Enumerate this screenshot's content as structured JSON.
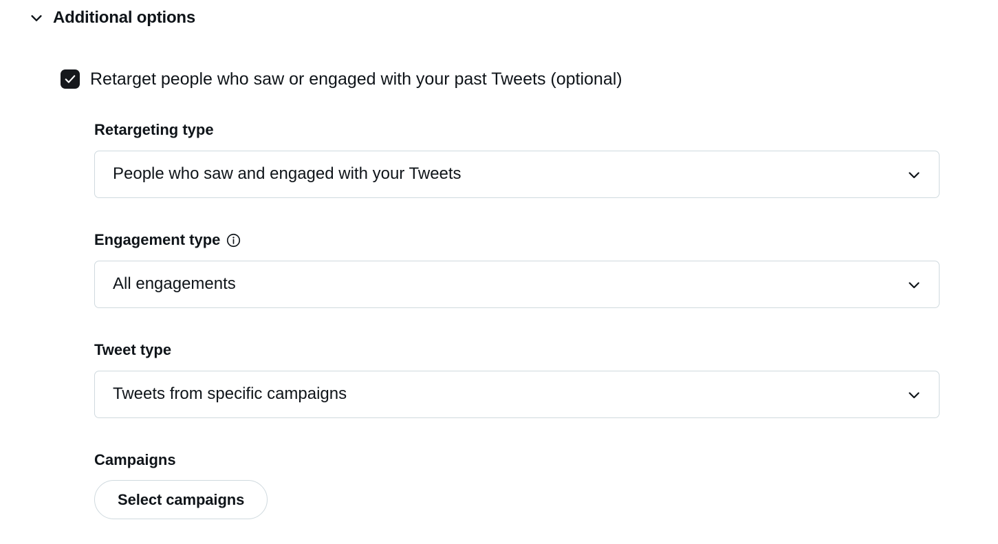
{
  "section": {
    "title": "Additional options",
    "toggle_icon": "chevron-down-icon",
    "expanded": true
  },
  "retarget_checkbox": {
    "label": "Retarget people who saw or engaged with your past Tweets (optional)",
    "checked": true,
    "check_icon": "checkmark-icon"
  },
  "fields": {
    "retargeting_type": {
      "label": "Retargeting type",
      "value": "People who saw and engaged with your Tweets",
      "chevron_icon": "chevron-down-icon"
    },
    "engagement_type": {
      "label": "Engagement type",
      "info_icon": "info-circle-icon",
      "value": "All engagements",
      "chevron_icon": "chevron-down-icon"
    },
    "tweet_type": {
      "label": "Tweet type",
      "value": "Tweets from specific campaigns",
      "chevron_icon": "chevron-down-icon"
    },
    "campaigns": {
      "label": "Campaigns",
      "button_label": "Select campaigns"
    }
  },
  "colors": {
    "text": "#0f1419",
    "border": "#cfd9de",
    "checkbox_fill": "#16181c",
    "background": "#ffffff"
  }
}
